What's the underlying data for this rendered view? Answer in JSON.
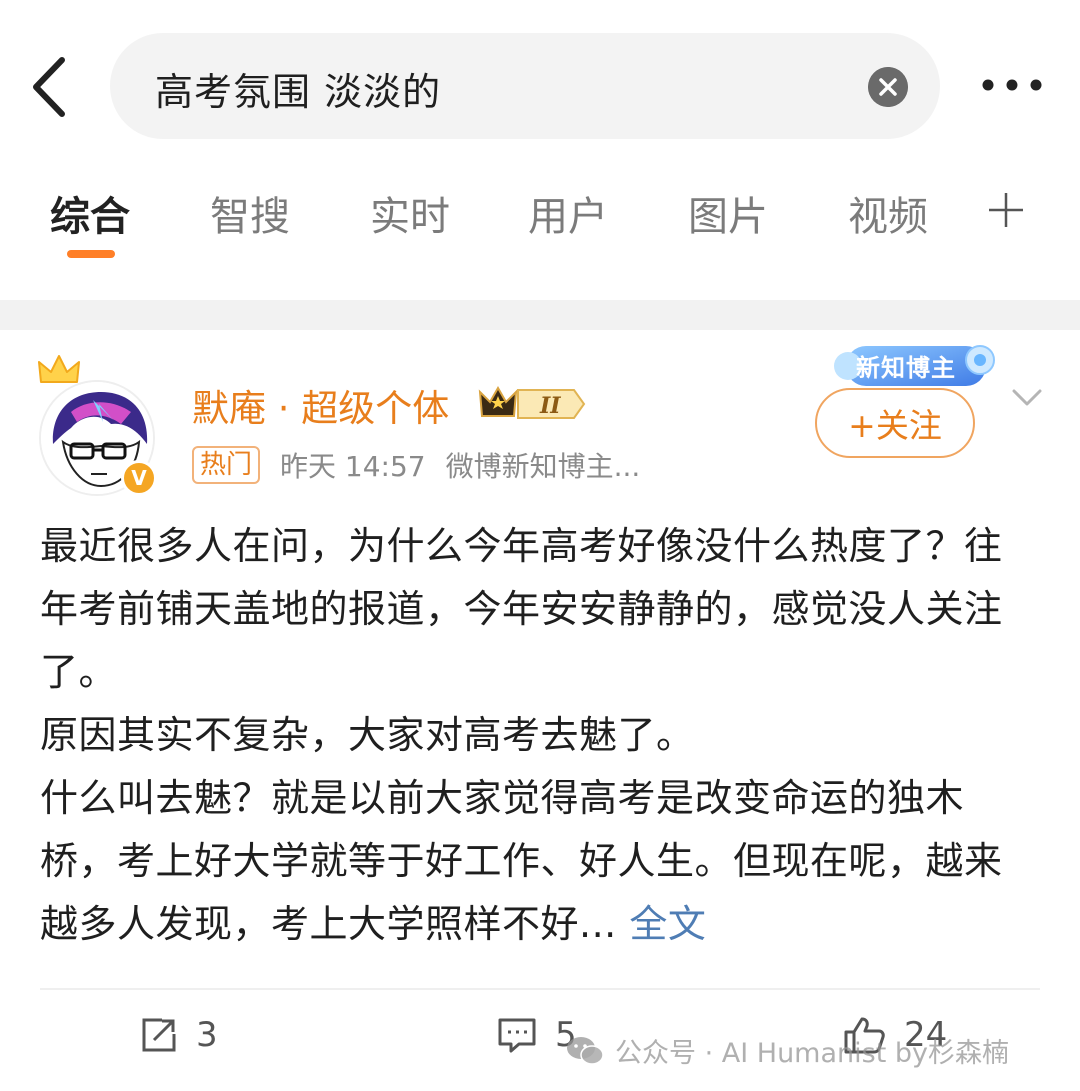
{
  "search": {
    "query": "高考氛围 淡淡的"
  },
  "tabs": [
    {
      "label": "综合",
      "active": true
    },
    {
      "label": "智搜",
      "active": false
    },
    {
      "label": "实时",
      "active": false
    },
    {
      "label": "用户",
      "active": false
    },
    {
      "label": "图片",
      "active": false
    },
    {
      "label": "视频",
      "active": false
    }
  ],
  "post": {
    "username": "默庵 · 超级个体",
    "level": "II",
    "hot_tag": "热门",
    "time": "昨天 14:57",
    "source": "微博新知博主...",
    "badge": "新知博主",
    "follow_label": "+关注",
    "body": [
      "最近很多人在问，为什么今年高考好像没什么热度了？往年考前铺天盖地的报道，今年安安静静的，感觉没人关注了。",
      "原因其实不复杂，大家对高考去魅了。",
      "什么叫去魅？就是以前大家觉得高考是改变命运的独木桥，考上好大学就等于好工作、好人生。但现在呢，越来越多人发现，考上大学照样不好..."
    ],
    "fulltext_label": "全文",
    "repost_count": "3",
    "comment_count": "5",
    "like_count": "24"
  },
  "watermark": "公众号 · AI Humanist by杉森楠",
  "colors": {
    "accent": "#ff7f27",
    "username": "#e87e1c",
    "link": "#4f7db4"
  }
}
